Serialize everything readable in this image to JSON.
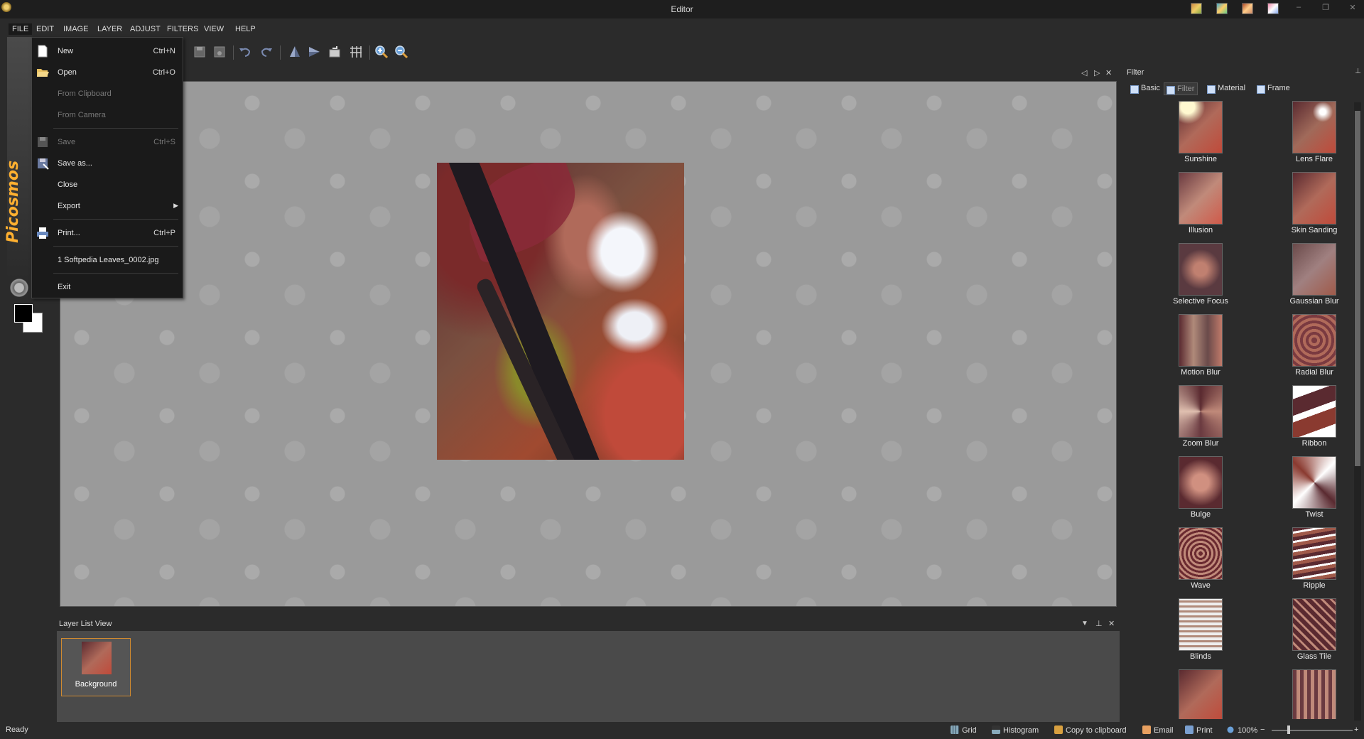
{
  "window": {
    "title": "Editor"
  },
  "menubar": {
    "items": [
      "FILE",
      "EDIT",
      "IMAGE",
      "LAYER",
      "ADJUST",
      "FILTERS",
      "VIEW",
      "HELP"
    ]
  },
  "file_menu": {
    "new_label": "New",
    "new_shortcut": "Ctrl+N",
    "open_label": "Open",
    "open_shortcut": "Ctrl+O",
    "from_clipboard_label": "From Clipboard",
    "from_camera_label": "From Camera",
    "save_label": "Save",
    "save_shortcut": "Ctrl+S",
    "save_as_label": "Save as...",
    "close_label": "Close",
    "export_label": "Export",
    "print_label": "Print...",
    "print_shortcut": "Ctrl+P",
    "recent_file_label": "1 Softpedia Leaves_0002.jpg",
    "exit_label": "Exit"
  },
  "brand": {
    "name": "Picosmos"
  },
  "layer_list": {
    "title": "Layer List View",
    "layer_name": "Background"
  },
  "filter_panel": {
    "title": "Filter",
    "tabs": [
      "Basic",
      "Filter",
      "Material",
      "Frame"
    ],
    "items": [
      "Sunshine",
      "Lens Flare",
      "Illusion",
      "Skin Sanding",
      "Selective Focus",
      "Gaussian Blur",
      "Motion Blur",
      "Radial Blur",
      "Zoom Blur",
      "Ribbon",
      "Bulge",
      "Twist",
      "Wave",
      "Ripple",
      "Blinds",
      "Glass Tile"
    ]
  },
  "status": {
    "text": "Ready",
    "grid_label": "Grid",
    "histogram_label": "Histogram",
    "copy_label": "Copy to clipboard",
    "email_label": "Email",
    "print_label": "Print",
    "zoom_label": "100%"
  }
}
